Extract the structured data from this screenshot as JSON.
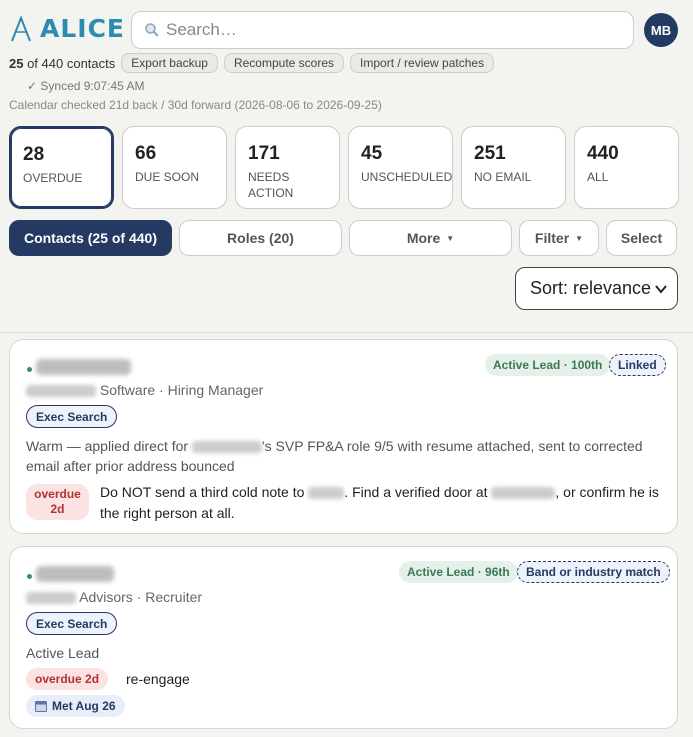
{
  "header": {
    "logo_text": "ALICE",
    "search_placeholder": "Search…",
    "avatar_initials": "MB"
  },
  "meta": {
    "count_shown": "25",
    "count_suffix": " of 440 contacts",
    "actions": [
      "Export backup",
      "Recompute scores",
      "Import / review patches"
    ],
    "synced": "✓ Synced 9:07:45 AM",
    "calendar_note": "Calendar checked 21d back / 30d forward (2026-08-06 to 2026-09-25)"
  },
  "stats": [
    {
      "num": "28",
      "label": "OVERDUE"
    },
    {
      "num": "66",
      "label": "DUE SOON"
    },
    {
      "num": "171",
      "label": "NEEDS ACTION"
    },
    {
      "num": "45",
      "label": "UNSCHEDULED"
    },
    {
      "num": "251",
      "label": "NO EMAIL"
    },
    {
      "num": "440",
      "label": "ALL"
    }
  ],
  "tabs": {
    "contacts": "Contacts (25 of 440)",
    "roles": "Roles (20)",
    "more": "More",
    "filter": "Filter",
    "select": "Select"
  },
  "sort_label": "Sort: relevance",
  "cards": [
    {
      "subtitle": "Software · Hiring Manager",
      "lead_badge": "Active Lead · 100th",
      "status_badge": "Linked",
      "tag": "Exec Search",
      "body_1a": "Warm — applied direct for ",
      "body_1b": "'s SVP FP&A role 9/5 with resume attached, sent to corrected",
      "body_2": "email after prior address bounced",
      "overdue_1": "overdue",
      "overdue_2": "2d",
      "action_1a": "Do NOT send a third cold note to ",
      "action_1b": ". Find a verified door at ",
      "action_1c": ", or confirm he is",
      "action_2": "the right person at all."
    },
    {
      "subtitle": "Advisors · Recruiter",
      "lead_badge": "Active Lead · 96th",
      "status_badge": "Band or industry match",
      "tag": "Exec Search",
      "body": "Active Lead",
      "overdue": "overdue 2d",
      "action": "re-engage",
      "met": "Met Aug 26"
    }
  ],
  "colors": {
    "navy": "#243a63",
    "brand": "#2b8bb0",
    "lead_green": "#3a7a55",
    "overdue_red": "#b23232"
  }
}
